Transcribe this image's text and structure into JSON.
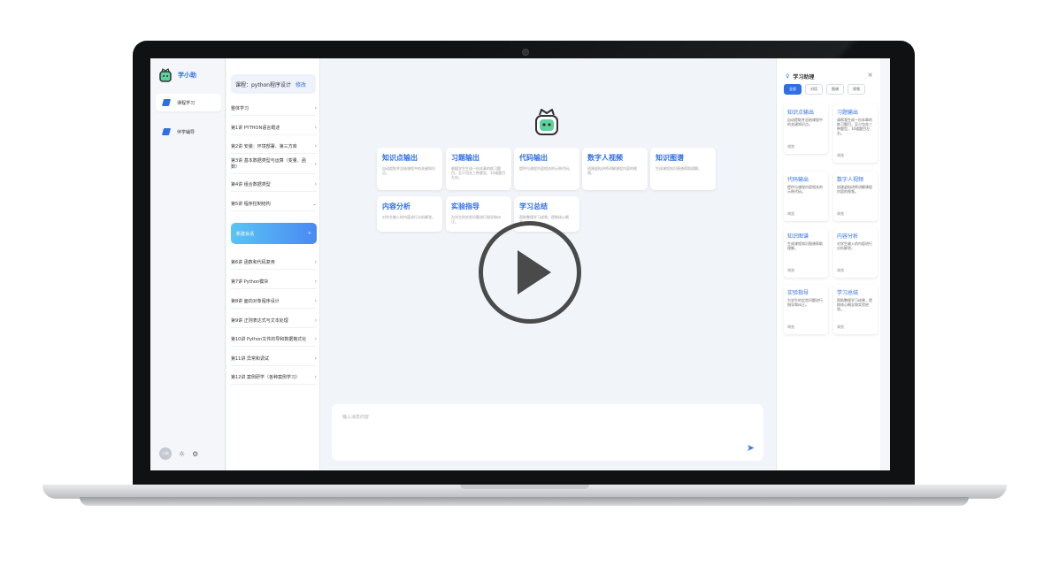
{
  "brand": {
    "name": "学小助"
  },
  "rail": {
    "items": [
      {
        "label": "课程学习",
        "active": true
      },
      {
        "label": "伴学辅导",
        "active": false
      }
    ],
    "avatar": "小助"
  },
  "course": {
    "label": "课程：python程序设计",
    "edit": "修改"
  },
  "chapters": [
    "整体学习",
    "第1讲 PYTHON语言概述",
    "第2讲 安装：环境部署、第三方库",
    "第3讲 基本数据类型与运算（变量、函数）",
    "第4讲 组合数据类型",
    "第5讲 程序控制结构",
    "第6讲 函数和代码复用",
    "第7讲 Python模块",
    "第8讲 面向对象程序设计",
    "第9讲 正则表达式与文本处理",
    "第10讲 Python文件的导和数据格式化",
    "第11讲 异常和调试",
    "第12讲 案例研学（各种案例学习）"
  ],
  "new_chat": {
    "label": "新建会话",
    "plus": "+"
  },
  "main_cards": [
    {
      "title": "知识点输出",
      "desc": "自动提取并总结课程中的关键知识点。"
    },
    {
      "title": "习题输出",
      "desc": "根据学生生成一份本章的练习题目，至少包含三种题型，10道题目左右。"
    },
    {
      "title": "代码输出",
      "desc": "提供与课程内容相关的示例代码。"
    },
    {
      "title": "数字人视频",
      "desc": "创建虚拟讲师讲解课程内容的视频。"
    },
    {
      "title": "知识图谱",
      "desc": "生成课程知识图谱帮助理解。"
    },
    {
      "title": "内容分析",
      "desc": "对学生输入的内容进行分析解答。"
    },
    {
      "title": "实验指导",
      "desc": "为学生的实验问题进行指导和纠正。"
    },
    {
      "title": "学习总结",
      "desc": "帮助整理学习成果，提炼核心概念。"
    }
  ],
  "input": {
    "placeholder": "输入消息内容"
  },
  "panel": {
    "title": "学习助理",
    "close": "×",
    "filters": [
      "全部",
      "对话",
      "图谱",
      "视频"
    ],
    "cards": [
      {
        "title": "知识点输出",
        "desc": "自动提取并总结课程中的关键知识点。",
        "more": "浏览"
      },
      {
        "title": "习题输出",
        "desc": "请帮我生成一份本章的练习题目，至少包含三种题型，10道题目左右。",
        "more": "浏览"
      },
      {
        "title": "代码输出",
        "desc": "提供与课程内容相关的示例代码。",
        "more": "浏览"
      },
      {
        "title": "数字人视频",
        "desc": "创建虚拟讲师讲解课程内容的视频。",
        "more": "浏览"
      },
      {
        "title": "知识图谱",
        "desc": "生成课程知识图谱帮助理解。",
        "more": "浏览"
      },
      {
        "title": "内容分析",
        "desc": "对学生输入的内容进行分析解答。",
        "more": "浏览"
      },
      {
        "title": "实验指导",
        "desc": "为学生的实验问题进行指导和纠正。",
        "more": "浏览"
      },
      {
        "title": "学习总结",
        "desc": "帮助整理学习成果，提炼核心概念和实验经验。",
        "more": "浏览"
      }
    ]
  },
  "colors": {
    "accent": "#2f6fe4",
    "gradient_start": "#59c4f5",
    "gradient_end": "#4a89f3"
  }
}
